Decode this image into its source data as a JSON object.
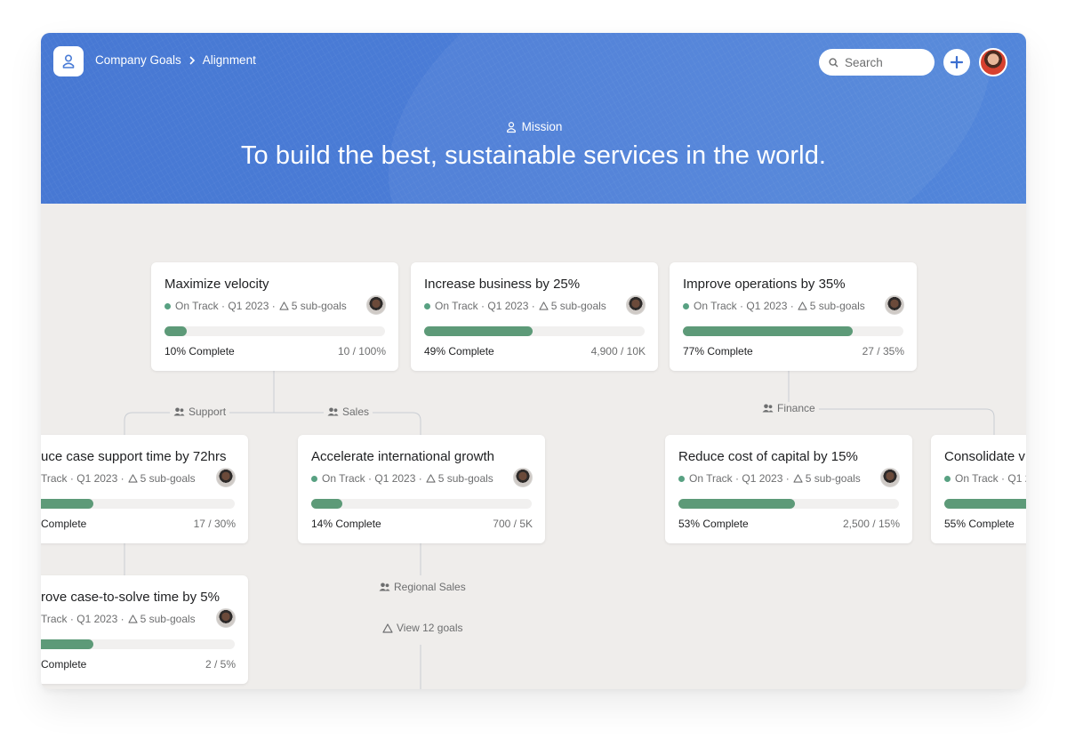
{
  "breadcrumb": {
    "root": "Company Goals",
    "current": "Alignment"
  },
  "search": {
    "placeholder": "Search"
  },
  "mission": {
    "label": "Mission",
    "text": "To build the best, sustainable services in the world."
  },
  "colors": {
    "banner": "#4a7cd6",
    "progress": "#5d9a78",
    "status_on_track": "#58a182",
    "canvas": "#efedeb"
  },
  "goals": {
    "velocity": {
      "title": "Maximize velocity",
      "status": "On Track",
      "period": "Q1 2023",
      "subgoals": "5 sub-goals",
      "complete": "10% Complete",
      "value": "10 / 100%",
      "progress": 0.1
    },
    "business": {
      "title": "Increase business by 25%",
      "status": "On Track",
      "period": "Q1 2023",
      "subgoals": "5 sub-goals",
      "complete": "49% Complete",
      "value": "4,900 / 10K",
      "progress": 0.49
    },
    "operations": {
      "title": "Improve operations by 35%",
      "status": "On Track",
      "period": "Q1 2023",
      "subgoals": "5 sub-goals",
      "complete": "77% Complete",
      "value": "27 / 35%",
      "progress": 0.77
    },
    "support_time": {
      "title": "uce case support time by 72hrs",
      "status": "Track",
      "period": "Q1 2023",
      "subgoals": "5 sub-goals",
      "complete": "Complete",
      "value": "17 / 30%",
      "progress": 0.36
    },
    "international": {
      "title": "Accelerate international growth",
      "status": "On Track",
      "period": "Q1 2023",
      "subgoals": "5 sub-goals",
      "complete": "14% Complete",
      "value": "700 / 5K",
      "progress": 0.14
    },
    "capital": {
      "title": "Reduce cost of capital by 15%",
      "status": "On Track",
      "period": "Q1 2023",
      "subgoals": "5 sub-goals",
      "complete": "53% Complete",
      "value": "2,500 / 15%",
      "progress": 0.53
    },
    "consolidate": {
      "title": "Consolidate v",
      "status": "On Track",
      "period": "Q1 2",
      "subgoals": "",
      "complete": "55% Complete",
      "value": "",
      "progress": 0.55
    },
    "case_solve": {
      "title": "rove case-to-solve time by 5%",
      "status": "Track",
      "period": "Q1 2023",
      "subgoals": "5 sub-goals",
      "complete": "Complete",
      "value": "2 / 5%",
      "progress": 0.36
    }
  },
  "groups": {
    "support": "Support",
    "sales": "Sales",
    "finance": "Finance",
    "regional_sales": "Regional Sales",
    "view_goals": "View 12 goals"
  }
}
